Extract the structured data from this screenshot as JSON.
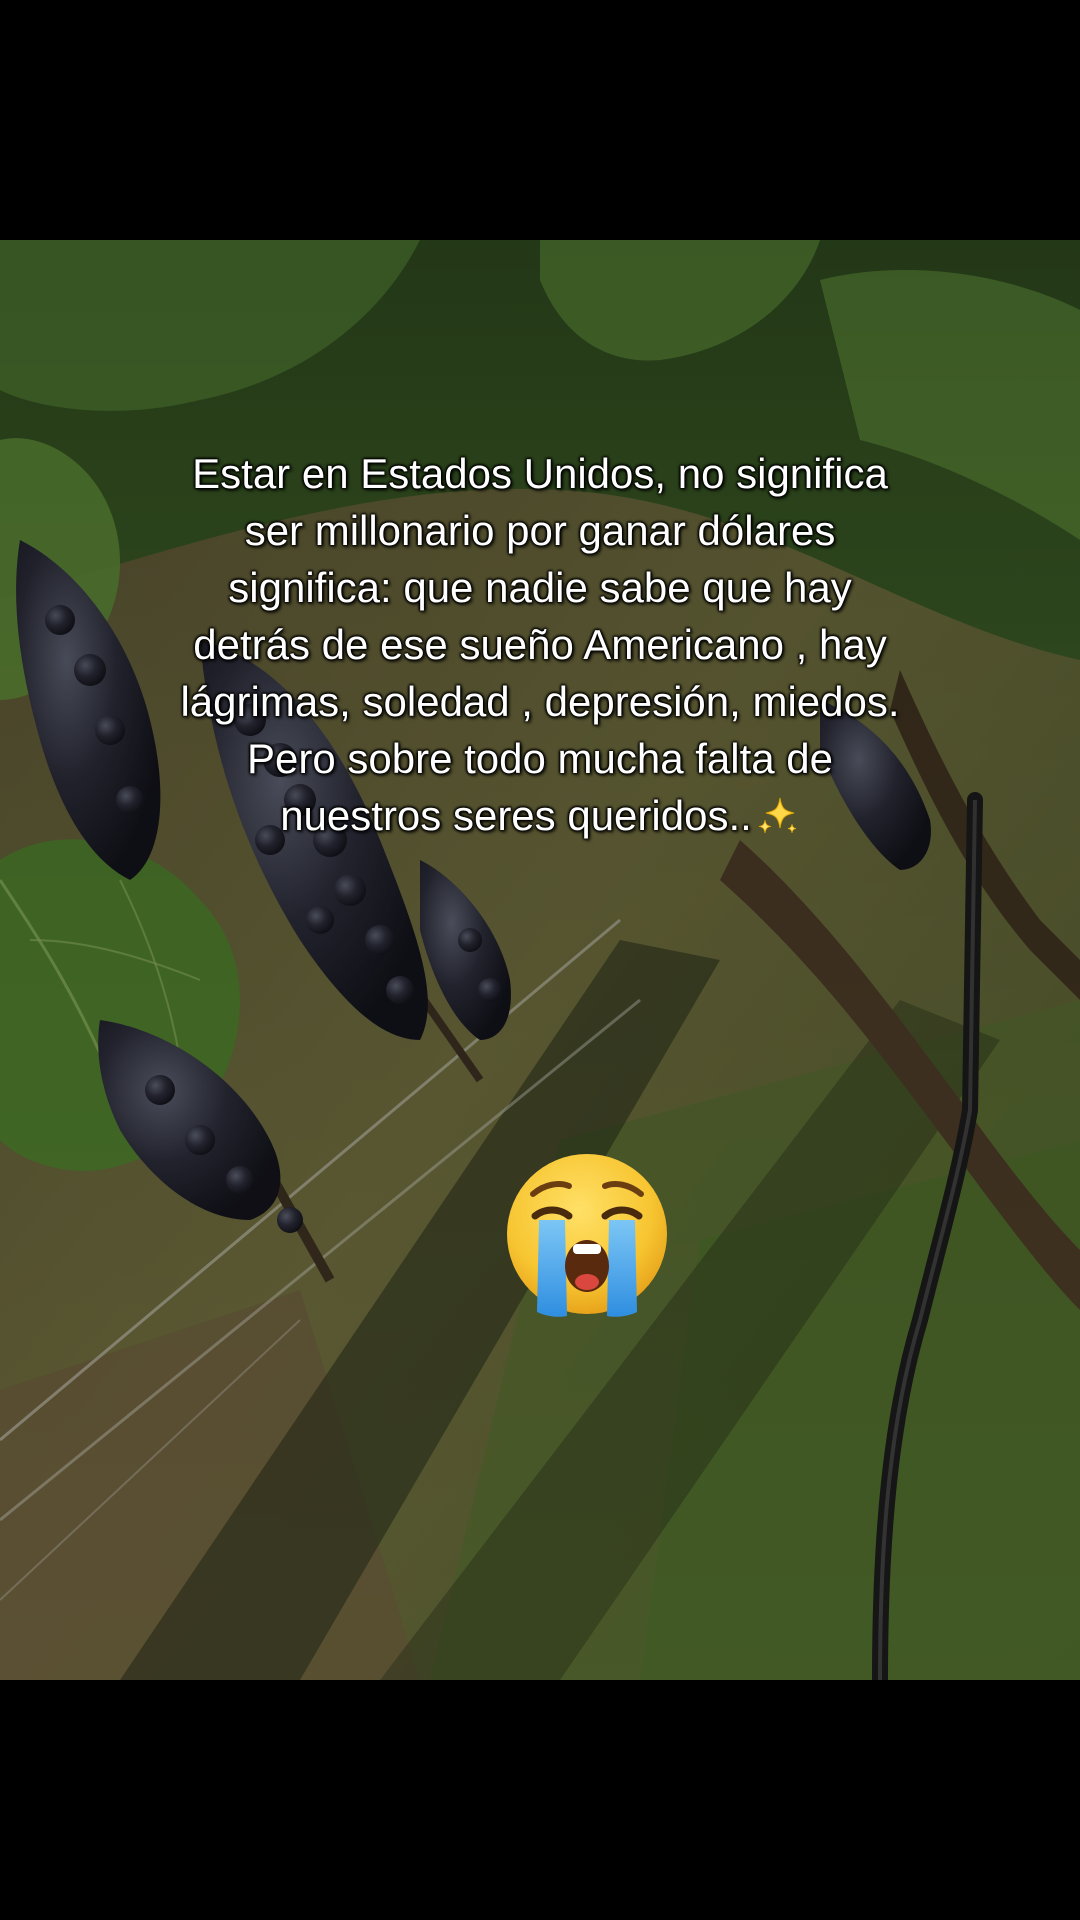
{
  "caption": {
    "lines": [
      "Estar en Estados Unidos, no significa",
      "ser millonario por ganar dólares",
      "significa: que nadie sabe que hay",
      "detrás de ese sueño Americano , hay",
      "lágrimas, soledad , depresión, miedos.",
      "Pero sobre todo mucha falta de",
      "nuestros seres queridos.."
    ],
    "trailing_emoji": "sparkles-icon"
  },
  "sticker": {
    "emoji": "loudly-crying-face-icon"
  },
  "photo": {
    "subject": "vineyard-grapes-on-vine"
  },
  "colors": {
    "letterbox": "#000000",
    "caption_text": "#ffffff",
    "leaf_green": "#3f6b2a",
    "grape_dark": "#1e1f2b",
    "soil": "#6b5a3c",
    "emoji_yellow": "#f7c531",
    "tear_blue": "#3aa0e8"
  }
}
